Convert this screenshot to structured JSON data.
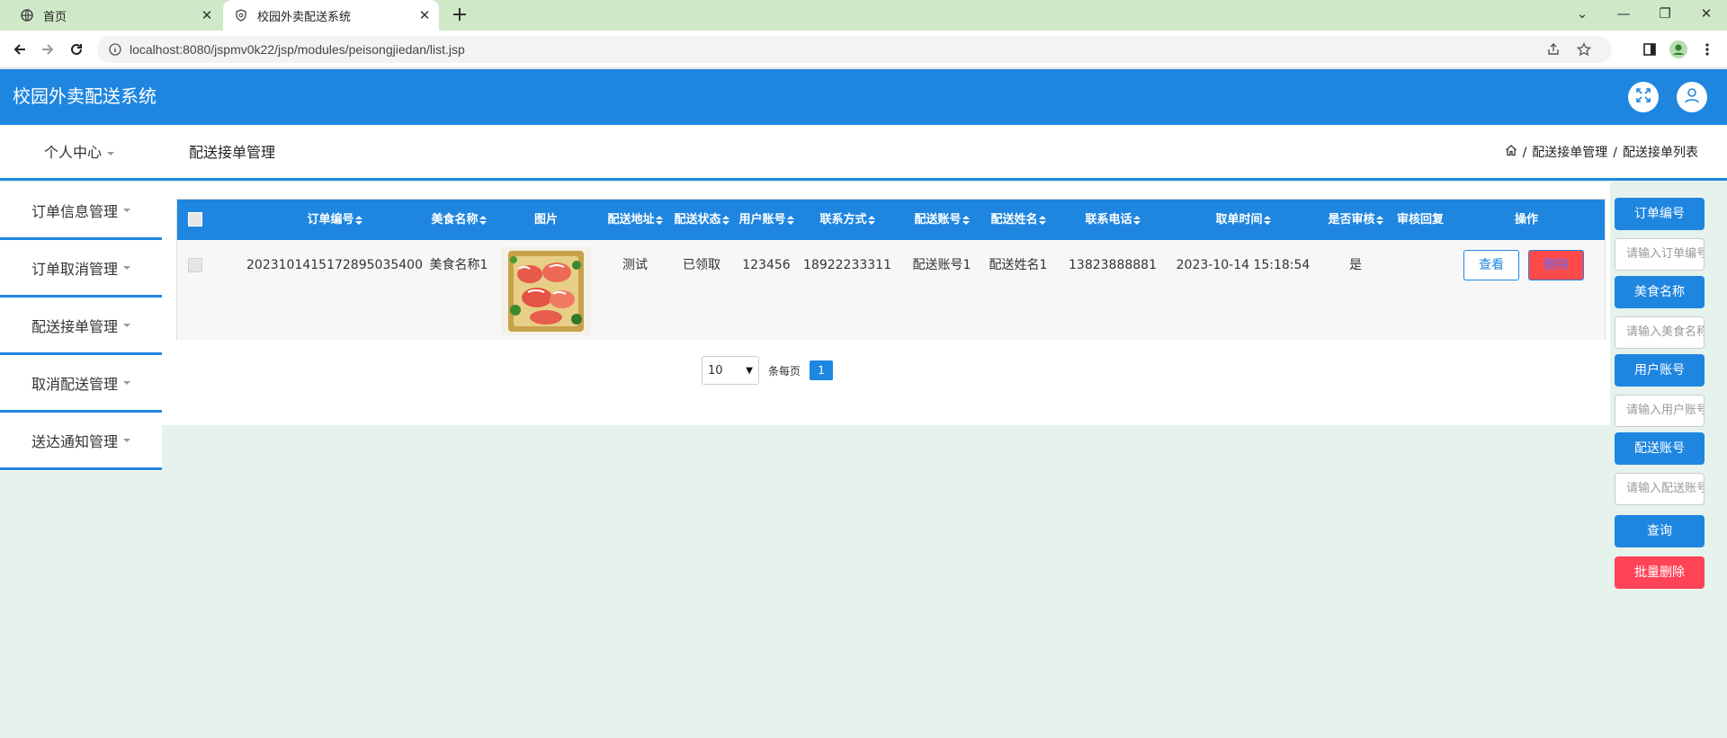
{
  "browser": {
    "tabs": [
      {
        "title": "首页"
      },
      {
        "title": "校园外卖配送系统"
      }
    ],
    "url": "localhost:8080/jspmv0k22/jsp/modules/peisongjiedan/list.jsp"
  },
  "app": {
    "title": "校园外卖配送系统",
    "personal_center": "个人中心"
  },
  "page": {
    "title": "配送接单管理",
    "breadcrumb": {
      "sep": "/",
      "level1": "配送接单管理",
      "level2": "配送接单列表"
    }
  },
  "sidebar": {
    "items": [
      {
        "label": "订单信息管理"
      },
      {
        "label": "订单取消管理"
      },
      {
        "label": "配送接单管理"
      },
      {
        "label": "取消配送管理"
      },
      {
        "label": "送达通知管理"
      }
    ]
  },
  "table": {
    "headers": {
      "order_no": "订单编号",
      "food_name": "美食名称",
      "image": "图片",
      "address": "配送地址",
      "status": "配送状态",
      "user_account": "用户账号",
      "contact": "联系方式",
      "courier_account": "配送账号",
      "courier_name": "配送姓名",
      "phone": "联系电话",
      "pickup_time": "取单时间",
      "reviewed": "是否审核",
      "review_reply": "审核回复",
      "actions": "操作"
    },
    "rows": [
      {
        "order_no": "2023101415172895035400",
        "food_name": "美食名称1",
        "address": "测试",
        "status": "已领取",
        "user_account": "123456",
        "contact": "18922233311",
        "courier_account": "配送账号1",
        "courier_name": "配送姓名1",
        "phone": "13823888881",
        "pickup_time": "2023-10-14 15:18:54",
        "reviewed": "是",
        "review_reply": "",
        "view_label": "查看",
        "delete_label": "删除"
      }
    ]
  },
  "pagination": {
    "page_size": "10",
    "per_page_label": "条每页",
    "current_page": "1"
  },
  "search": {
    "order_no_label": "订单编号",
    "order_no_placeholder": "请输入订单编号",
    "food_name_label": "美食名称",
    "food_name_placeholder": "请输入美食名称",
    "user_account_label": "用户账号",
    "user_account_placeholder": "请输入用户账号",
    "courier_account_label": "配送账号",
    "courier_account_placeholder": "请输入配送账号",
    "query_label": "查询",
    "batch_delete_label": "批量删除"
  },
  "colors": {
    "primary": "#1f86e0",
    "danger": "#ff4458",
    "tabstrip": "#cfe8c8",
    "background": "#e6f2ec"
  }
}
